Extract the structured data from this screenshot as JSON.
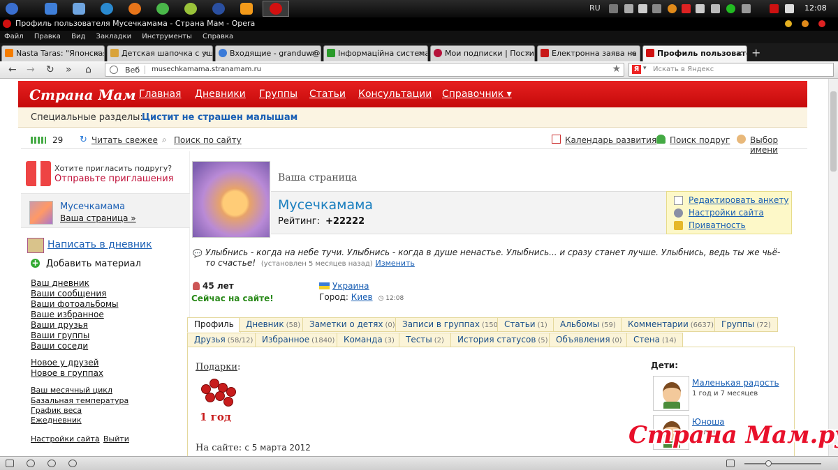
{
  "taskbar": {
    "lang": "RU",
    "clock": "12:08"
  },
  "window": {
    "title": "Профиль пользователя Мусечкамама - Страна Мам - Opera",
    "menu": [
      "Файл",
      "Правка",
      "Вид",
      "Закладки",
      "Инструменты",
      "Справка"
    ]
  },
  "tabs": [
    {
      "label": "Nasta Taras: \"Японская\"..."
    },
    {
      "label": "Детская шапочка с уш..."
    },
    {
      "label": "Входящие - granduw@..."
    },
    {
      "label": "Інформаційна система..."
    },
    {
      "label": "Мои подписки | Пости..."
    },
    {
      "label": "Електронна заява на у..."
    },
    {
      "label": "Профиль пользовател..."
    }
  ],
  "address": {
    "web_label": "Веб",
    "url": "musechkamama.stranamam.ru",
    "search_placeholder": "Искать в Яндекс"
  },
  "site": {
    "logo": "Страна Мам",
    "nav": [
      "Главная",
      "Дневники",
      "Группы",
      "Статьи",
      "Консультации",
      "Справочник ▾"
    ],
    "special_label": "Специальные разделы:",
    "special_link": "Цистит не страшен малышам"
  },
  "toolbar": {
    "count": "29",
    "fresh": "Читать свежее",
    "search": "Поиск по сайту",
    "calendar": "Календарь развития",
    "find_friend": "Поиск подруг",
    "name_choice": "Выбор имени"
  },
  "sidebar": {
    "invite_hint": "Хотите пригласить подругу?",
    "invite_link": "Отправьте приглашения",
    "username": "Мусечкамама",
    "your_page": "Ваша страница »",
    "write_diary": "Написать в дневник",
    "add_material": "Добавить материал",
    "links": [
      "Ваш дневник",
      "Ваши сообщения",
      "Ваши фотоальбомы",
      "Ваше избранное",
      "Ваши друзья",
      "Ваши группы",
      "Ваши соседи"
    ],
    "links2": [
      "Новое у друзей",
      "Новое в группах"
    ],
    "links3": [
      "Ваш месячный цикл",
      "Базальная температура",
      "График веса",
      "Ежедневник"
    ],
    "settings": "Настройки сайта",
    "sep": "|",
    "logout": "Выйти"
  },
  "profile": {
    "your_page": "Ваша страница",
    "name": "Мусечкамама",
    "rating_label": "Рейтинг:",
    "rating_value": "+22222",
    "actions": [
      "Редактировать анкету",
      "Настройки сайта",
      "Приватность"
    ],
    "status_text": "Улыбнись - когда на небе тучи. Улыбнись - когда в душе ненастье. Улыбнись... и сразу станет лучше. Улыбнись, ведь ты же чьё-то счастье!",
    "status_meta": "(установлен 5 месяцев назад)",
    "status_change": "Изменить",
    "age": "45 лет",
    "online": "Сейчас на сайте!",
    "country": "Украина",
    "city_label": "Город:",
    "city": "Киев",
    "local_time": "12:08"
  },
  "profile_tabs_row1": [
    {
      "label": "Профиль",
      "count": ""
    },
    {
      "label": "Дневник",
      "count": "(58)"
    },
    {
      "label": "Заметки о детях",
      "count": "(0)"
    },
    {
      "label": "Записи в группах",
      "count": "(150)"
    },
    {
      "label": "Статьи",
      "count": "(1)"
    },
    {
      "label": "Альбомы",
      "count": "(59)"
    },
    {
      "label": "Комментарии",
      "count": "(6637)"
    },
    {
      "label": "Группы",
      "count": "(72)"
    }
  ],
  "profile_tabs_row2": [
    {
      "label": "Друзья",
      "count": "(58/12)"
    },
    {
      "label": "Избранное",
      "count": "(1840)"
    },
    {
      "label": "Команда",
      "count": "(3)"
    },
    {
      "label": "Тесты",
      "count": "(2)"
    },
    {
      "label": "История статусов",
      "count": "(5)"
    },
    {
      "label": "Объявления",
      "count": "(0)"
    },
    {
      "label": "Стена",
      "count": "(14)"
    }
  ],
  "content": {
    "gifts_label": "Подарки",
    "gift_caption": "1 год",
    "onsite_label": "На сайте:",
    "onsite_value": "с 5 марта 2012",
    "kids_label": "Дети:",
    "kids": [
      {
        "name": "Маленькая радость",
        "age": "1 год и 7 месяцев"
      },
      {
        "name": "Юноша",
        "age": "17 лет"
      }
    ],
    "watermark": "Страна Мам.ру"
  },
  "colors": {
    "brand_red": "#d8141a",
    "link_blue": "#1a5fb4",
    "online_green": "#2a8a1a"
  }
}
